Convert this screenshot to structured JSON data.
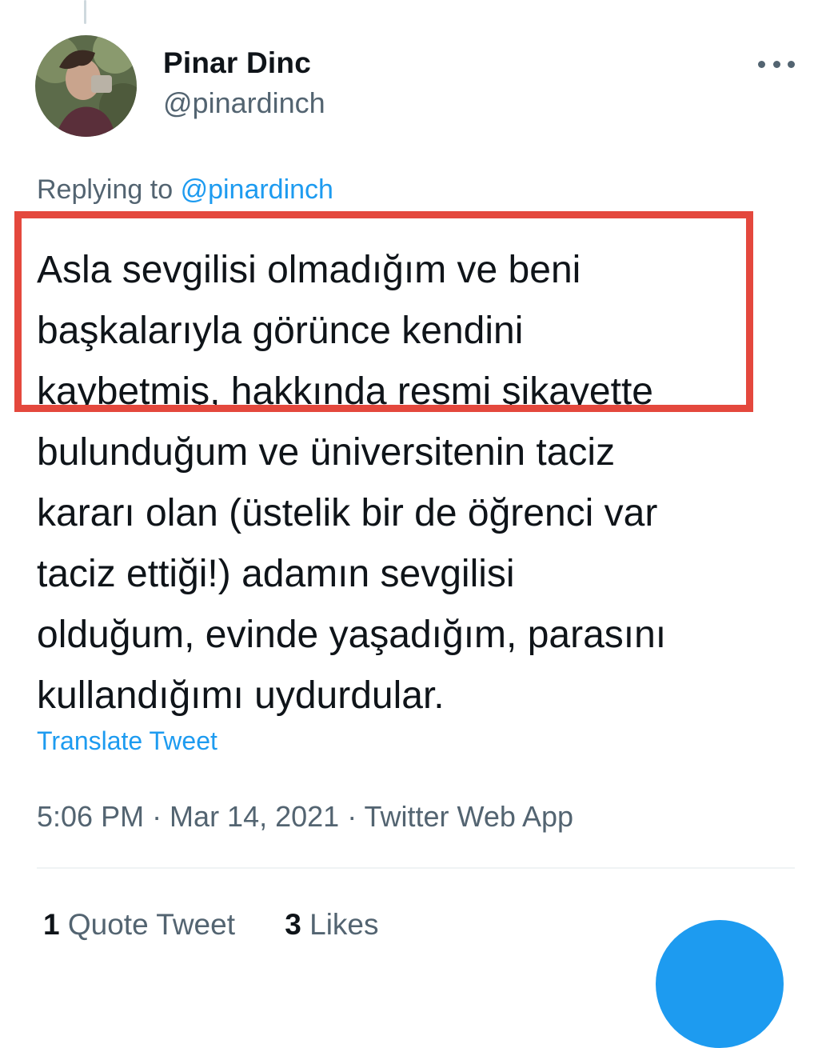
{
  "tweet": {
    "author": {
      "name": "Pinar Dinc",
      "handle": "@pinardinch"
    },
    "replying_prefix": "Replying to",
    "replying_handle": "@pinardinch",
    "text_lines": [
      "Asla sevgilisi olmadığım ve beni",
      "başkalarıyla görünce kendini",
      "kaybetmiş, hakkında resmi şikayette",
      "bulunduğum ve üniversitenin taciz",
      "kararı olan (üstelik bir de öğrenci var",
      "taciz ettiği!) adamın sevgilisi",
      "olduğum, evinde yaşadığım, parasını",
      "kullandığımı uydurdular."
    ],
    "translate_label": "Translate Tweet",
    "metadata": "5:06 PM · Mar 14, 2021 · Twitter Web App",
    "stats": {
      "quote_count": "1",
      "quote_label": "Quote Tweet",
      "like_count": "3",
      "like_label": "Likes"
    }
  },
  "icons": {
    "more": "more-horizontal-icon",
    "compose": "compose-fab"
  },
  "colors": {
    "accent": "#1d9bf0",
    "highlight_box": "#e4483d",
    "secondary_text": "#536471",
    "primary_text": "#0f1419"
  }
}
